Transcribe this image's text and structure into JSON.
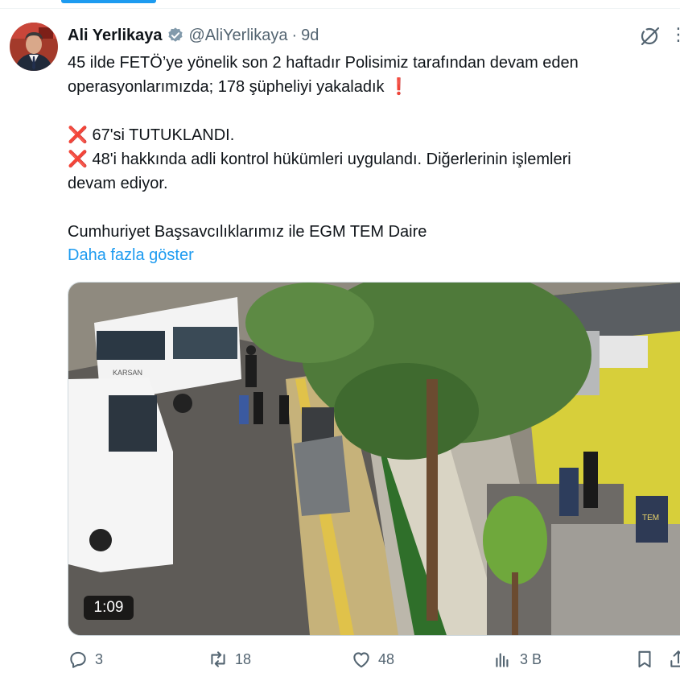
{
  "tweet": {
    "author_name": "Ali Yerlikaya",
    "handle": "@AliYerlikaya",
    "separator": "·",
    "time": "9d",
    "lines": [
      "45 ilde FETÖ’ye yönelik son 2 haftadır Polisimiz tarafından devam eden",
      "operasyonlarımızda; 178 şüpheliyi yakaladık ❗"
    ],
    "item1": "❌ 67'si TUTUKLANDI.",
    "item2_line1": "❌ 48'i hakkında adli kontrol hükümleri uygulandı. Diğerlerinin işlemleri",
    "item2_line2": "devam ediyor.",
    "last_line": "Cumhuriyet Başsavcılıklarımız ile EGM TEM Daire",
    "show_more": "Daha fazla göster"
  },
  "video": {
    "duration": "1:09"
  },
  "video_scene": {
    "bus_label": "KARSAN",
    "vest_label": "TEM"
  },
  "actions": {
    "replies": "3",
    "reposts": "18",
    "likes": "48",
    "views": "3 B"
  },
  "colors": {
    "accent": "#1d9bf0",
    "text": "#0f1419",
    "muted": "#536471",
    "cross": "#f4212e"
  },
  "icons": [
    "verified-badge-icon",
    "grok-icon",
    "more-icon",
    "reply-icon",
    "repost-icon",
    "like-icon",
    "views-icon",
    "bookmark-icon",
    "share-icon"
  ]
}
